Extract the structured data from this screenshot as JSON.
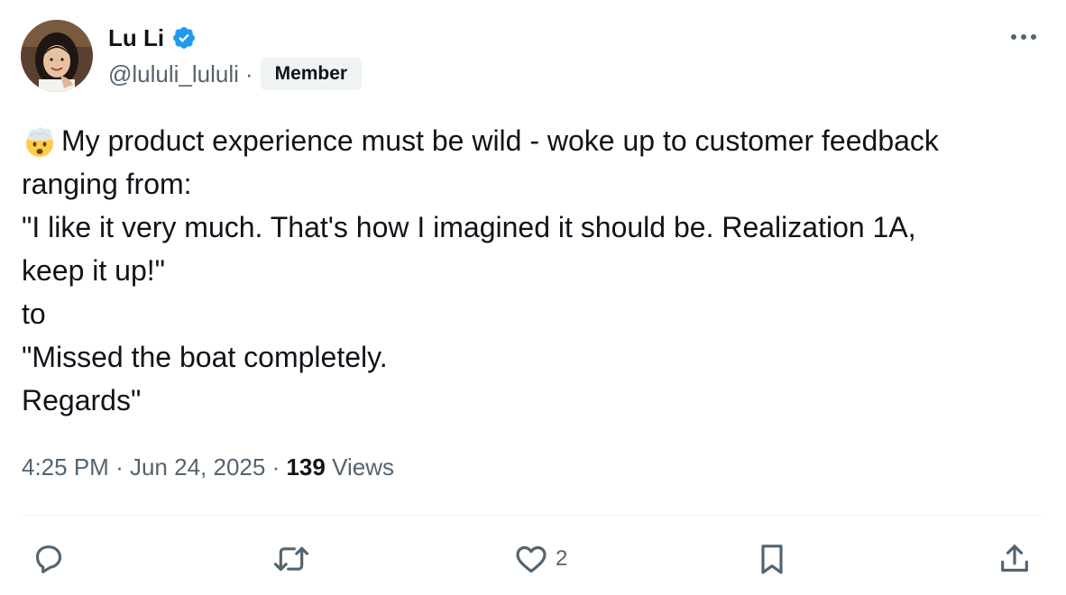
{
  "author": {
    "display_name": "Lu Li",
    "handle": "@lululi_lululi",
    "separator": "·",
    "badge": "Member",
    "verified_icon": "verified-badge-icon",
    "verified_color": "#1d9bf0"
  },
  "tweet": {
    "emoji": "exploding-head",
    "lines": [
      "My product experience must be wild - woke up to customer feedback",
      "ranging from:",
      "\"I like it very much. That's how I imagined it should be. Realization 1A,",
      "keep it up!\"",
      "to",
      "\"Missed the boat completely.",
      "Regards\""
    ]
  },
  "meta": {
    "time": "4:25 PM",
    "sep1": "·",
    "date": "Jun 24, 2025",
    "sep2": "·",
    "views_count": "139",
    "views_label": "Views"
  },
  "actions": {
    "reply": {
      "icon": "reply-icon",
      "count": ""
    },
    "repost": {
      "icon": "repost-icon",
      "count": ""
    },
    "like": {
      "icon": "like-icon",
      "count": "2"
    },
    "bookmark": {
      "icon": "bookmark-icon",
      "count": ""
    },
    "share": {
      "icon": "share-icon",
      "count": ""
    }
  },
  "colors": {
    "text_primary": "#0f1419",
    "text_secondary": "#536471",
    "verified_blue": "#1d9bf0",
    "divider": "#eff3f4"
  }
}
